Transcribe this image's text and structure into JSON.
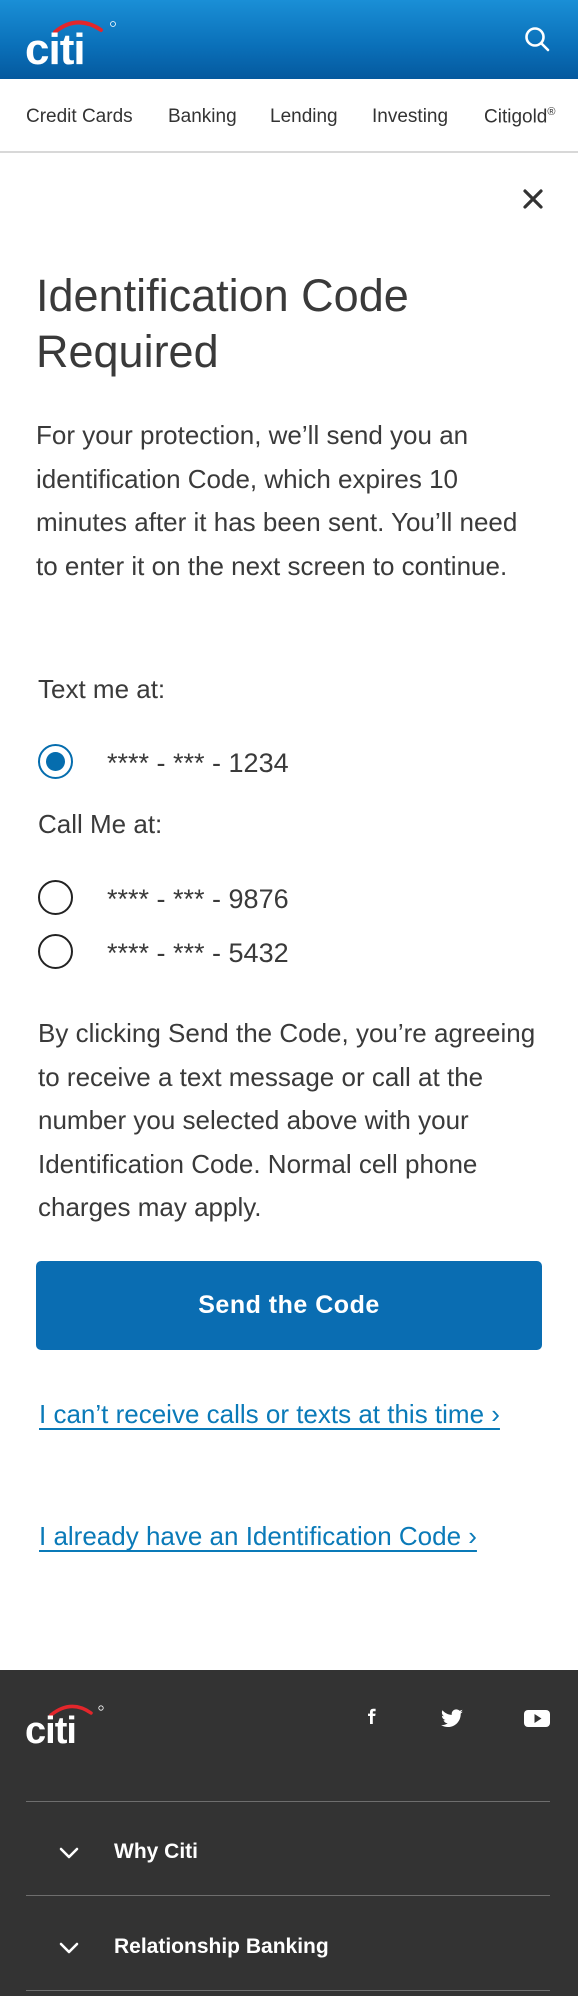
{
  "header": {
    "logo_text": "citi",
    "search_icon": "search-icon"
  },
  "nav": {
    "items": [
      "Credit Cards",
      "Banking",
      "Lending",
      "Investing",
      "Citigold"
    ],
    "citigold_mark": "®"
  },
  "dialog": {
    "close_icon": "close-icon",
    "title": "Identification Code Required",
    "intro": "For your protection, we’ll send you an identification Code, which expires 10 minutes after it has been sent. You’ll need to enter it on the next screen to continue.",
    "text_label": "Text me at:",
    "text_options": [
      {
        "number": "**** - *** - 1234",
        "selected": true
      }
    ],
    "call_label": "Call Me at:",
    "call_options": [
      {
        "number": "**** - *** - 9876",
        "selected": false
      },
      {
        "number": "**** - *** - 5432",
        "selected": false
      }
    ],
    "disclaimer": "By clicking Send the Code, you’re agreeing to receive a text message or call at the number you selected above with your Identification Code. Normal cell phone charges may apply.",
    "send_button": "Send the Code",
    "link_cant_receive": "I can’t receive calls or texts at this time ›",
    "link_have_code": "I already have an Identification Code ›"
  },
  "footer": {
    "logo_text": "citi",
    "social_icons": [
      "facebook-icon",
      "twitter-icon",
      "youtube-icon"
    ],
    "sections": [
      "Why Citi",
      "Relationship Banking"
    ]
  },
  "colors": {
    "brand_blue": "#056dae",
    "link_blue": "#0a7ab8",
    "footer_bg": "#333333",
    "citi_arc_red": "#e3262b"
  }
}
